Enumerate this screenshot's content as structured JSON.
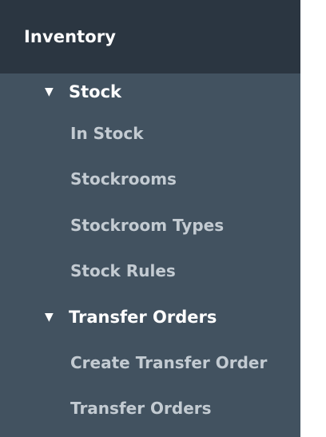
{
  "header": {
    "title": "Inventory"
  },
  "groups": [
    {
      "label": "Stock",
      "expanded": true,
      "icon": "triangle-down-icon",
      "items": [
        {
          "label": "In Stock"
        },
        {
          "label": "Stockrooms"
        },
        {
          "label": "Stockroom Types"
        },
        {
          "label": "Stock Rules"
        }
      ]
    },
    {
      "label": "Transfer Orders",
      "expanded": true,
      "icon": "triangle-down-icon",
      "items": [
        {
          "label": "Create Transfer Order"
        },
        {
          "label": "Transfer Orders"
        }
      ]
    }
  ],
  "colors": {
    "header_bg": "#2b3641",
    "nav_bg": "#425260",
    "group_text": "#ffffff",
    "item_text": "#c3cbd2"
  }
}
